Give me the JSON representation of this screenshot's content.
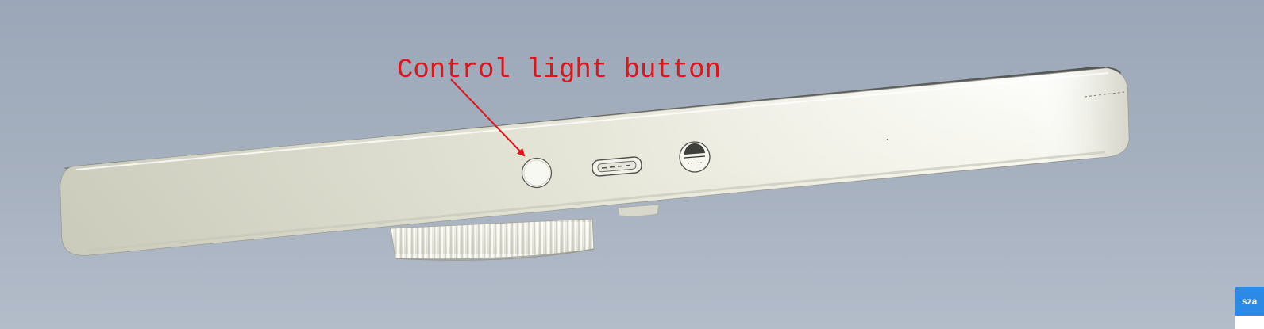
{
  "annotation": {
    "label": "Control light button",
    "color": "#e0141a"
  },
  "device": {
    "body_color": "#f4f4ec",
    "top_color": "#6a6a6a",
    "parts": [
      "control-light-button",
      "micro-usb-port",
      "audio-jack",
      "knurled-dial"
    ]
  },
  "corner_widget": {
    "tab_text": "sza",
    "accent": "#2b8ae6"
  }
}
